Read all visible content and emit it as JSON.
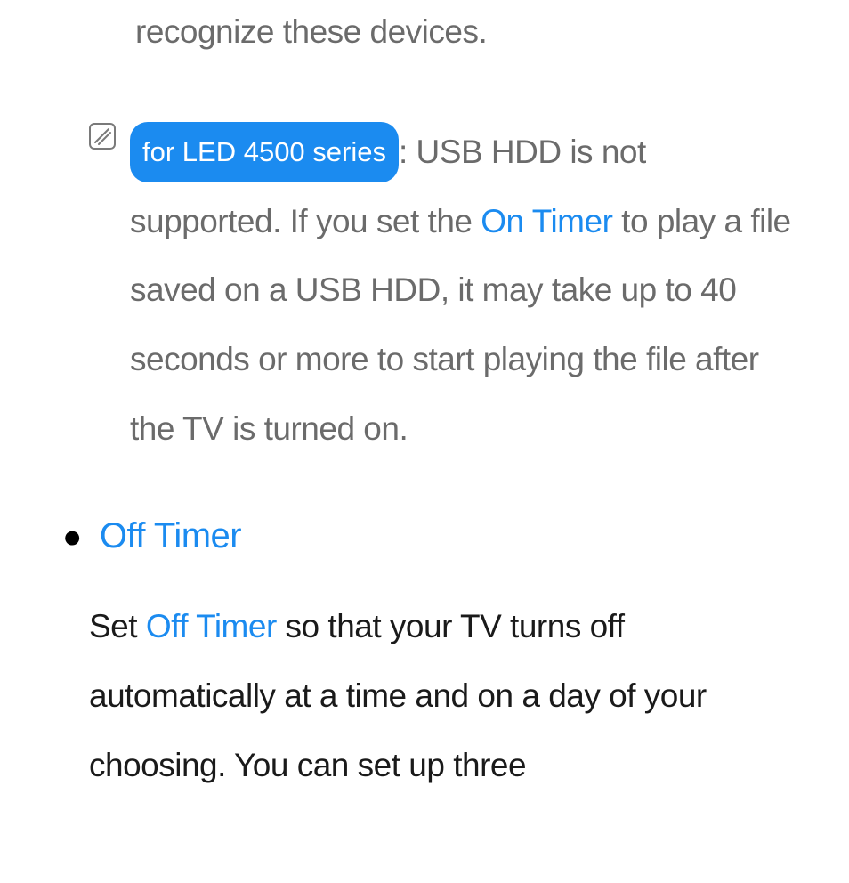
{
  "line0": "recognize these devices.",
  "note": {
    "pill": "for LED 4500 series",
    "before": ": USB HDD is not supported. If you set the ",
    "link1": "On Timer",
    "after": " to play a file saved on a USB HDD, it may take up to 40 seconds or more to start playing the file after the TV is turned on."
  },
  "bullet_symbol": "●",
  "heading": "Off Timer",
  "para": {
    "p1": "Set ",
    "link": "Off Timer",
    "p2": " so that your TV turns off automatically at a time and on a day of your choosing. You can set up three"
  }
}
